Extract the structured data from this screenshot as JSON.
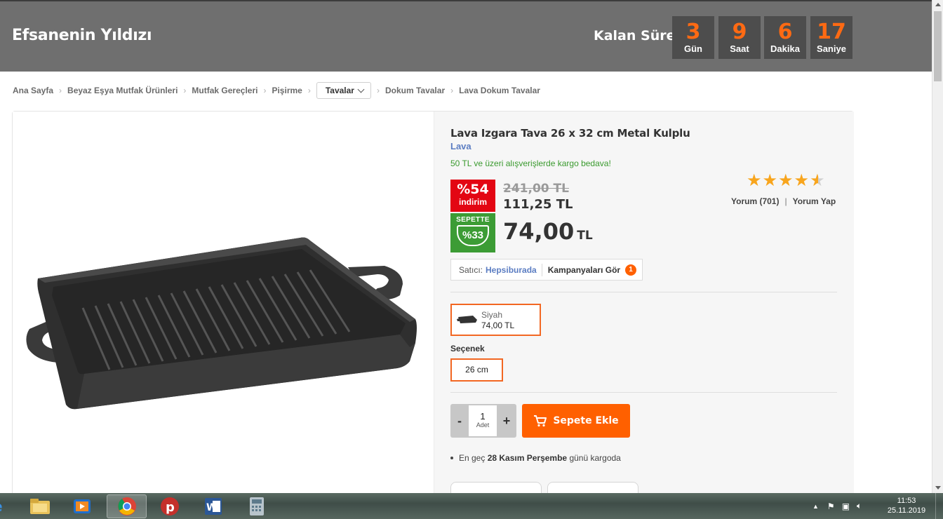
{
  "banner": {
    "title": "Efsanenin Yıldızı",
    "countdown_label": "Kalan Süre",
    "countdown": [
      {
        "value": "3",
        "unit": "Gün"
      },
      {
        "value": "9",
        "unit": "Saat"
      },
      {
        "value": "6",
        "unit": "Dakika"
      },
      {
        "value": "17",
        "unit": "Saniye"
      }
    ]
  },
  "breadcrumb": {
    "items": [
      "Ana Sayfa",
      "Beyaz Eşya Mutfak Ürünleri",
      "Mutfak Gereçleri",
      "Pişirme"
    ],
    "dropdown": "Tavalar",
    "after": [
      "Dokum Tavalar",
      "Lava Dokum Tavalar"
    ]
  },
  "product": {
    "title": "Lava Izgara Tava 26 x 32 cm Metal Kulplu",
    "brand": "Lava",
    "shipping_note": "50 TL ve üzeri alışverişlerde kargo bedava!",
    "discount_badge": {
      "percent": "%54",
      "label": "indirim"
    },
    "basket_badge": {
      "label": "SEPETTE",
      "percent": "%33"
    },
    "old_price": "241,00 TL",
    "price": "111,25 TL",
    "basket_price": "74,00",
    "basket_currency": "TL",
    "rating": 4.5,
    "reviews_label": "Yorum (701)",
    "write_review": "Yorum Yap",
    "seller_label": "Satıcı:",
    "seller_name": "Hepsiburada",
    "campaign_label": "Kampanyaları Gör",
    "campaign_count": "1",
    "variant": {
      "name": "Siyah",
      "price": "74,00 TL"
    },
    "option_label": "Seçenek",
    "option_value": "26 cm",
    "quantity": "1",
    "quantity_unit": "Adet",
    "qty_minus": "-",
    "qty_plus": "+",
    "add_to_cart": "Sepete Ekle",
    "delivery_prefix": "En geç",
    "delivery_date": "28 Kasım Perşembe",
    "delivery_suffix": "günü kargoda"
  },
  "taskbar": {
    "apps": [
      "internet-explorer",
      "file-explorer",
      "media-player",
      "chrome",
      "psiphon",
      "word",
      "calculator"
    ],
    "time": "11:53",
    "date": "25.11.2019"
  },
  "colors": {
    "accent": "#ff6000",
    "banner": "#6f6f6f",
    "countdown_number": "#ff6a13",
    "discount_red": "#e30613",
    "basket_green": "#3c9c35",
    "link_blue": "#5b7dc2",
    "star": "#f8a51d"
  }
}
